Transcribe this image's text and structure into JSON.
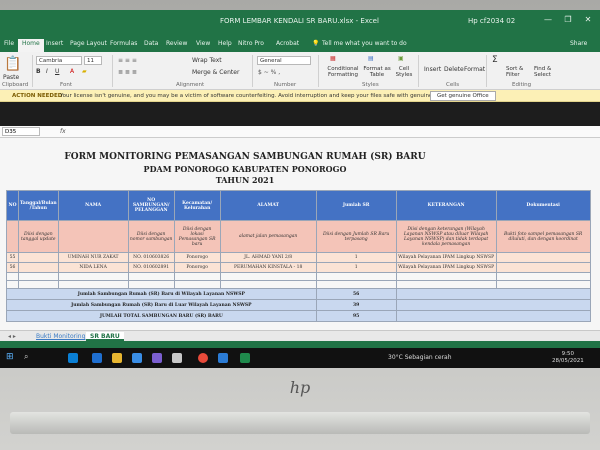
{
  "window": {
    "title": "FORM LEMBAR KENDALI SR BARU.xlsx - Excel",
    "user": "Hp cf2034 02",
    "minimize": "—",
    "restore": "❐",
    "close": "✕"
  },
  "tabs": [
    "File",
    "Home",
    "Insert",
    "Page Layout",
    "Formulas",
    "Data",
    "Review",
    "View",
    "Help",
    "Nitro Pro",
    "Acrobat"
  ],
  "tell_me": "Tell me what you want to do",
  "share": "Share",
  "ribbon": {
    "paste": "Paste",
    "clipboard": "Clipboard",
    "font_name": "Cambria",
    "font_size": "11",
    "font_group": "Font",
    "wrap_text": "Wrap Text",
    "merge_center": "Merge & Center",
    "alignment_group": "Alignment",
    "number_format": "General",
    "number_group": "Number",
    "conditional": "Conditional Formatting",
    "format_table": "Format as Table",
    "cell_styles": "Cell Styles",
    "styles_group": "Styles",
    "insert": "Insert",
    "delete": "Delete",
    "format": "Format",
    "cells_group": "Cells",
    "sort_filter": "Sort & Filter",
    "find_select": "Find & Select",
    "editing_group": "Editing"
  },
  "actionbar": {
    "label": "ACTION NEEDED",
    "message": "Your license isn't genuine, and you may be a victim of software counterfeiting. Avoid interruption and keep your files safe with genuine Office today.",
    "button": "Get genuine Office"
  },
  "formula": {
    "namebox": "D35",
    "fx": "fx"
  },
  "sheet": {
    "title1": "FORM MONITORING PEMASANGAN SAMBUNGAN RUMAH (SR) BARU",
    "title2": "PDAM PONOROGO KABUPATEN PONOROGO",
    "title3": "TAHUN 2021",
    "headers": [
      "NO",
      "Tanggal/Bulan /Tahun",
      "NAMA",
      "NO SAMBUNGAN/ PELANGGAN",
      "Kecamatan/ Kelurahan",
      "ALAMAT",
      "Jumlah SR",
      "KETERANGAN",
      "Dokumentasi"
    ],
    "instructions": [
      "",
      "Diisi dengan tanggal update",
      "",
      "Diisi dengan nomor sambungan",
      "Diisi dengan lokasi Pemasangan SR baru",
      "alamat jalan pemasangan",
      "Diisi dengan Jumlah SR Baru terpasang",
      "Diisi dengan keterangan (Wilayah Layanan NSWSP atau diluar Wilayah Layanan NSWSP) dan tidak terdapat kendala pemasangan",
      "Bukti foto sampel pemasangan SR diluluti, dan dengan koordinat"
    ],
    "rows": [
      [
        "55",
        "",
        "UMINAH NUR ZAKAT",
        "NO. 010603826",
        "Ponorogo",
        "JL. AHMAD YANI 2/8",
        "1",
        "Wilayah Pelayanan IPAM Lingkup NSWSP",
        ""
      ],
      [
        "56",
        "",
        "NIDA LENA",
        "NO. 010602891",
        "Ponorogo",
        "PERUMAHAN KINSTALA - 18",
        "1",
        "Wilayah Pelayanan IPAM Lingkup NSWSP",
        ""
      ]
    ],
    "totals": [
      {
        "label": "Jumlah Sambungan Rumah (SR) Baru di Wilayah Layanan NSWSP",
        "value": "56"
      },
      {
        "label": "Jumlah Sambungan Rumah (SR) Baru di Luar Wilayah Layanan NSWSP",
        "value": "39"
      },
      {
        "label": "JUMLAH TOTAL SAMBUNGAN BARU (SR) BARU",
        "value": "95"
      }
    ]
  },
  "sheet_tabs": [
    "Bukti Monitoring",
    "SR BARU"
  ],
  "taskbar": {
    "weather": "30°C  Sebagian cerah",
    "time": "9:50",
    "date": "28/05/2021"
  },
  "brand": "hp",
  "colors": {
    "excel_green": "#217346",
    "header_blue": "#4472c4",
    "instruction_row": "#f4c4b8",
    "total_row": "#c9d8ef"
  }
}
